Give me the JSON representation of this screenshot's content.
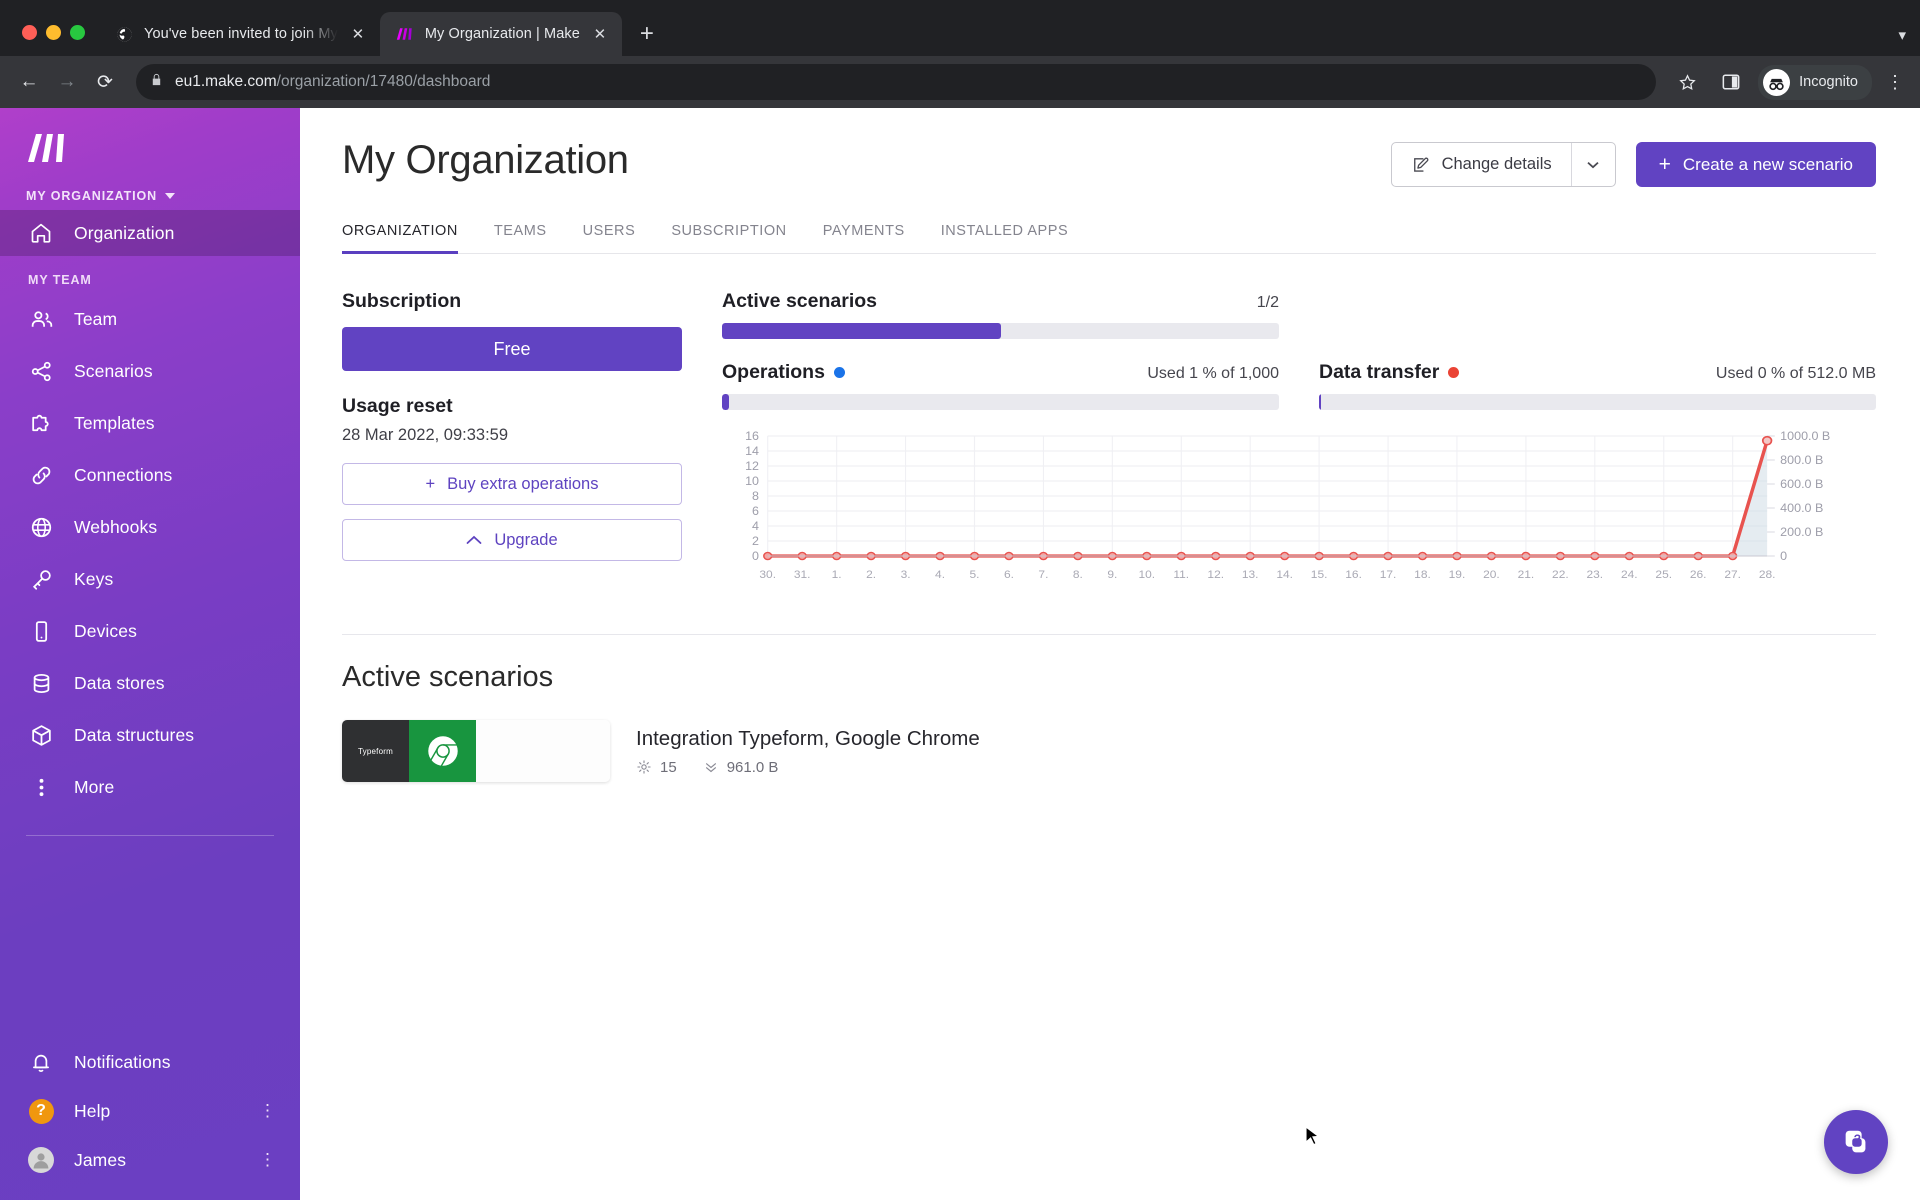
{
  "browser": {
    "tabs": [
      {
        "title": "You've been invited to join My",
        "favicon": "globe-icon",
        "active": false
      },
      {
        "title": "My Organization | Make",
        "favicon": "make-logo-icon",
        "active": true
      }
    ],
    "new_tab_label": "+",
    "close_label": "✕",
    "tabstrip_chevron": "▾",
    "back_icon": "←",
    "forward_icon": "→",
    "reload_icon": "⟳",
    "lock_icon": "lock-icon",
    "url_domain": "eu1.make.com",
    "url_path": "/organization/17480/dashboard",
    "bookmark_icon": "star-icon",
    "sidepanel_icon": "side-panel-icon",
    "profile_label": "Incognito",
    "menu_icon": "⋮"
  },
  "sidebar": {
    "logo": "make-logo",
    "org_switcher": "MY ORGANIZATION",
    "org_items": [
      {
        "label": "Organization",
        "icon": "home-icon",
        "active": true
      }
    ],
    "team_section_label": "MY TEAM",
    "team_items": [
      {
        "label": "Team",
        "icon": "people-icon"
      },
      {
        "label": "Scenarios",
        "icon": "share-nodes-icon"
      },
      {
        "label": "Templates",
        "icon": "puzzle-icon"
      },
      {
        "label": "Connections",
        "icon": "link-icon"
      },
      {
        "label": "Webhooks",
        "icon": "globe-icon"
      },
      {
        "label": "Keys",
        "icon": "key-icon"
      },
      {
        "label": "Devices",
        "icon": "device-icon"
      },
      {
        "label": "Data stores",
        "icon": "database-icon"
      },
      {
        "label": "Data structures",
        "icon": "cube-icon"
      },
      {
        "label": "More",
        "icon": "dots-vertical-icon"
      }
    ],
    "bottom_items": [
      {
        "label": "Notifications",
        "icon": "bell-icon",
        "trail": ""
      },
      {
        "label": "Help",
        "icon": "help-badge-icon",
        "trail": "⋮"
      },
      {
        "label": "James",
        "icon": "avatar-icon",
        "trail": "⋮"
      }
    ]
  },
  "header": {
    "title": "My Organization",
    "change_details_label": "Change details",
    "change_details_icon": "edit-square-icon",
    "dropdown_icon": "▾",
    "create_scenario_label": "Create a new scenario",
    "create_plus_icon": "+"
  },
  "tabs": [
    {
      "label": "ORGANIZATION",
      "active": true
    },
    {
      "label": "TEAMS",
      "active": false
    },
    {
      "label": "USERS",
      "active": false
    },
    {
      "label": "SUBSCRIPTION",
      "active": false
    },
    {
      "label": "PAYMENTS",
      "active": false
    },
    {
      "label": "INSTALLED APPS",
      "active": false
    }
  ],
  "subscription": {
    "heading": "Subscription",
    "plan": "Free",
    "usage_reset_heading": "Usage reset",
    "usage_reset_value": "28 Mar 2022, 09:33:59",
    "buy_label": "Buy extra operations",
    "buy_icon": "+",
    "upgrade_label": "Upgrade",
    "upgrade_icon": "^"
  },
  "meters": {
    "active_scenarios": {
      "title": "Active scenarios",
      "value": "1/2",
      "percent": 50,
      "color": "#6143c2"
    },
    "operations": {
      "title": "Operations",
      "value": "Used 1 % of 1,000",
      "percent": 1,
      "dot_color": "#1a73e8",
      "color": "#6143c2"
    },
    "data_transfer": {
      "title": "Data transfer",
      "value": "Used 0 % of 512.0 MB",
      "percent": 0,
      "dot_color": "#ea4335",
      "color": "#6143c2"
    }
  },
  "chart_data": {
    "type": "line",
    "title": "",
    "xlabel": "",
    "ylabel": "",
    "x": [
      "30.",
      "31.",
      "1.",
      "2.",
      "3.",
      "4.",
      "5.",
      "6.",
      "7.",
      "8.",
      "9.",
      "10.",
      "11.",
      "12.",
      "13.",
      "14.",
      "15.",
      "16.",
      "17.",
      "18.",
      "19.",
      "20.",
      "21.",
      "22.",
      "23.",
      "24.",
      "25.",
      "26.",
      "27.",
      "28."
    ],
    "left_axis": {
      "label": "Operations",
      "ticks": [
        0,
        2,
        4,
        6,
        8,
        10,
        12,
        14,
        16
      ],
      "ylim": [
        0,
        16
      ],
      "color": "#1a73e8"
    },
    "right_axis": {
      "label": "Data transfer",
      "ticks": [
        "0",
        "200.0 B",
        "400.0 B",
        "600.0 B",
        "800.0 B",
        "1000.0 B"
      ],
      "ylim": [
        0,
        1000
      ],
      "color": "#ea4335"
    },
    "series": [
      {
        "name": "Operations",
        "axis": "left",
        "color": "#1a73e8",
        "values": [
          0,
          0,
          0,
          0,
          0,
          0,
          0,
          0,
          0,
          0,
          0,
          0,
          0,
          0,
          0,
          0,
          0,
          0,
          0,
          0,
          0,
          0,
          0,
          0,
          0,
          0,
          0,
          0,
          0,
          15
        ]
      },
      {
        "name": "Data transfer",
        "axis": "right",
        "color": "#e8534f",
        "fill": "#cfdde5",
        "values": [
          0,
          0,
          0,
          0,
          0,
          0,
          0,
          0,
          0,
          0,
          0,
          0,
          0,
          0,
          0,
          0,
          0,
          0,
          0,
          0,
          0,
          0,
          0,
          0,
          0,
          0,
          0,
          0,
          0,
          961
        ]
      }
    ],
    "grid": true,
    "legend": "inline-with-meter-titles"
  },
  "active_scenarios_section": {
    "heading": "Active scenarios",
    "items": [
      {
        "name": "Integration Typeform, Google Chrome",
        "operations": "15",
        "operations_icon": "gear-icon",
        "transfer": "961.0 B",
        "transfer_icon": "chevrons-down-icon",
        "apps": [
          "Typeform",
          "Google Chrome"
        ]
      }
    ]
  },
  "fab": {
    "icon": "help-chat-icon"
  }
}
